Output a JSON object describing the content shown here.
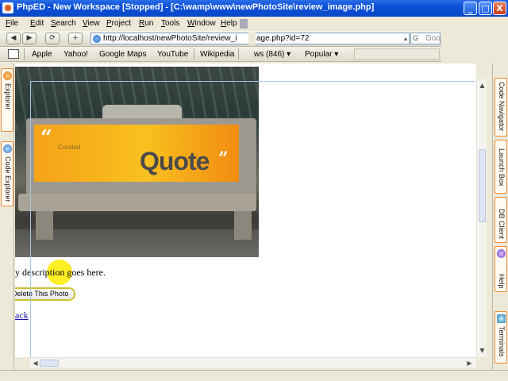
{
  "window": {
    "title": "PhpED - New Workspace [Stopped] - [C:\\wamp\\www\\newPhotoSite\\review_image.php]",
    "controls": {
      "minimize": "_",
      "maximize": "□",
      "close": "X"
    }
  },
  "menu": [
    {
      "label": "File",
      "mnemonic": "F",
      "rest": "ile"
    },
    {
      "label": "Edit",
      "mnemonic": "E",
      "rest": "dit"
    },
    {
      "label": "Search",
      "mnemonic": "S",
      "rest": "earch"
    },
    {
      "label": "View",
      "mnemonic": "V",
      "rest": "iew"
    },
    {
      "label": "Project",
      "mnemonic": "P",
      "rest": "roject"
    },
    {
      "label": "Run",
      "mnemonic": "R",
      "rest": "un"
    },
    {
      "label": "Tools",
      "mnemonic": "T",
      "rest": "ools"
    },
    {
      "label": "Window",
      "mnemonic": "W",
      "rest": "indow"
    },
    {
      "label": "Help",
      "mnemonic": "H",
      "rest": "elp"
    }
  ],
  "nav": {
    "back": "◀",
    "forward": "▶",
    "reload": "⟳",
    "new": "+",
    "url_part1": "http://localhost/newPhotoSite/review_i",
    "url_part2": "age.php?id=72",
    "search_hint": "Goo",
    "search_engine": "G"
  },
  "bookmarks": {
    "items": [
      "Apple",
      "Yahoo!",
      "Google Maps",
      "YouTube",
      "Wikipedia",
      "ws (846) ▾",
      "Popular ▾"
    ]
  },
  "left_panel": {
    "tabs": [
      "Explorer",
      "Code Explorer"
    ]
  },
  "right_panel": {
    "tabs": [
      "Code Navigator",
      "Launch Box",
      "DB Client",
      "Help",
      "Terminals"
    ]
  },
  "page": {
    "photo": {
      "ad_brand": "Quote",
      "ad_small": "Curated",
      "quote_open": "“",
      "quote_close": "”"
    },
    "description": "y description goes here.",
    "delete_button": "Delete This Photo",
    "back_link": "ack"
  },
  "colors": {
    "titlebar": "#0a4fd9",
    "tab_border": "#f08a30",
    "ad_orange": "#f6a318",
    "highlight": "#ffec00",
    "link": "#1a0dab"
  }
}
